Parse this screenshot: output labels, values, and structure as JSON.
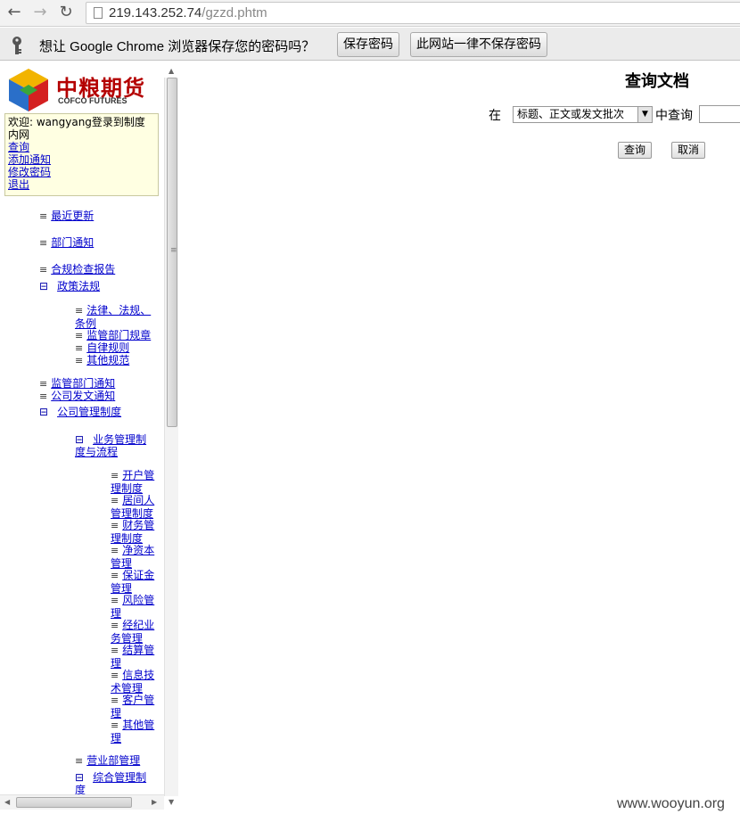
{
  "browser": {
    "url_host": "219.143.252.74",
    "url_path": "/gzzd.phtm"
  },
  "infobar": {
    "prompt": "想让 Google Chrome 浏览器保存您的密码吗？",
    "save_button": "保存密码",
    "never_button": "此网站一律不保存密码"
  },
  "logo": {
    "cn": "中粮期货",
    "en": "COFCO  FUTURES"
  },
  "userbox": {
    "welcome": "欢迎: wangyang登录到制度内网",
    "links": [
      "查询",
      "添加通知",
      "修改密码",
      "退出"
    ]
  },
  "tree": {
    "recent": "最近更新",
    "dept_notice": "部门通知",
    "compliance": "合规检查报告",
    "policy": "政策法规",
    "policy_children": [
      "法律、法规、条例",
      "监管部门规章",
      "自律规则",
      "其他规范"
    ],
    "reg_notice": "监管部门通知",
    "company_notice": "公司发文通知",
    "company_mgmt": "公司管理制度",
    "business_mgmt": "业务管理制度与流程",
    "business_children": [
      "开户管理制度",
      "居间人管理制度",
      "财务管理制度",
      "净资本管理",
      "保证金管理",
      "风险管理",
      "经纪业务管理",
      "结算管理",
      "信息技术管理",
      "客户管理",
      "其他管理"
    ],
    "branch_mgmt": "营业部管理",
    "general_mgmt": "综合管理制度"
  },
  "main": {
    "title": "查询文档",
    "in_label": "在",
    "field_selected": "标题、正文或发文批次",
    "query_label": "中查询",
    "query_value": "",
    "search_button": "查询",
    "cancel_button": "取消"
  },
  "watermark": "www.wooyun.org"
}
